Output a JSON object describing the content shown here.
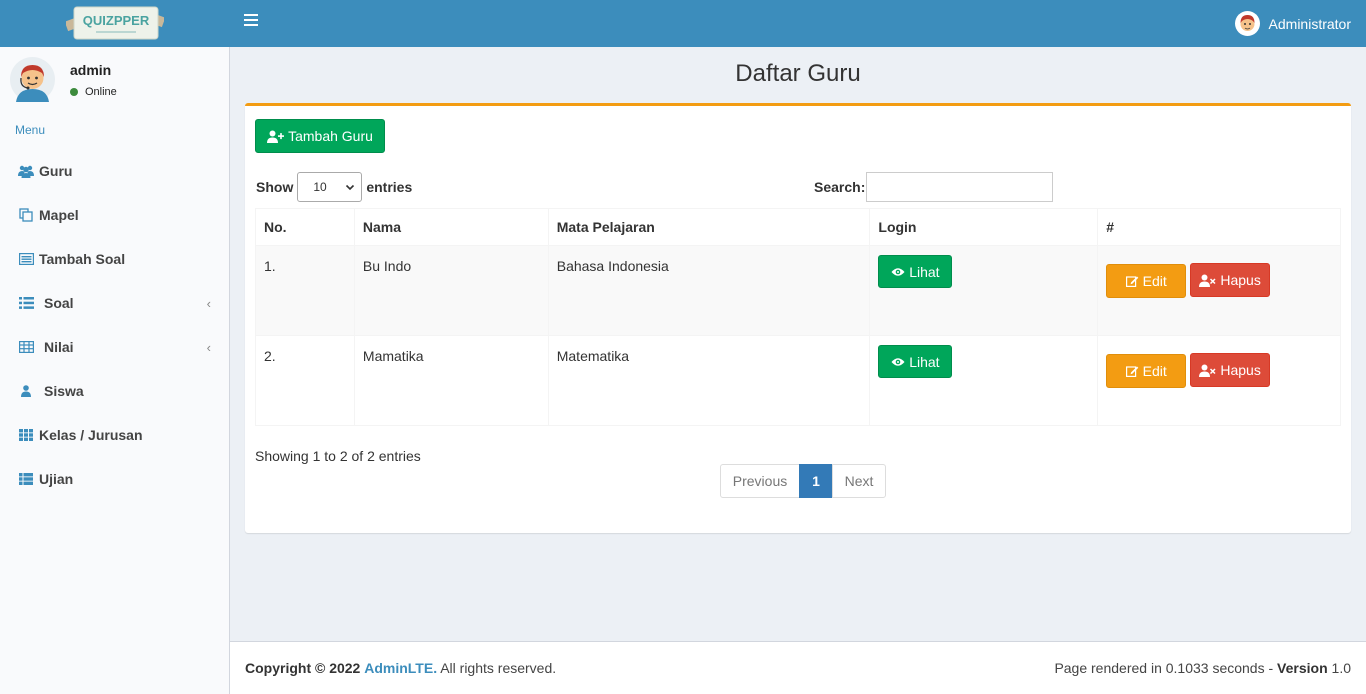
{
  "header": {
    "logo_text": "QUIZPPER",
    "user_label": "Administrator"
  },
  "sidebar": {
    "user_name": "admin",
    "user_status": "Online",
    "menu_header": "Menu",
    "items": [
      {
        "label": "Guru",
        "icon": "users-icon",
        "has_children": false
      },
      {
        "label": "Mapel",
        "icon": "copy-icon",
        "has_children": false
      },
      {
        "label": "Tambah Soal",
        "icon": "list-alt-icon",
        "has_children": false
      },
      {
        "label": "Soal",
        "icon": "list-icon",
        "has_children": true
      },
      {
        "label": "Nilai",
        "icon": "table-icon",
        "has_children": true
      },
      {
        "label": "Siswa",
        "icon": "user-icon",
        "has_children": false
      },
      {
        "label": "Kelas / Jurusan",
        "icon": "grid-icon",
        "has_children": false
      },
      {
        "label": "Ujian",
        "icon": "th-list-icon",
        "has_children": false
      }
    ]
  },
  "page": {
    "title": "Daftar Guru",
    "add_button": "Tambah Guru",
    "show_label": "Show",
    "entries_value": "10",
    "entries_label": "entries",
    "search_label": "Search:",
    "search_value": ""
  },
  "table": {
    "columns": [
      "No.",
      "Nama",
      "Mata Pelajaran",
      "Login",
      "#"
    ],
    "rows": [
      {
        "no": "1.",
        "nama": "Bu Indo",
        "mapel": "Bahasa Indonesia",
        "login_btn": "Lihat",
        "edit_btn": "Edit",
        "delete_btn": "Hapus"
      },
      {
        "no": "2.",
        "nama": "Mamatika",
        "mapel": "Matematika",
        "login_btn": "Lihat",
        "edit_btn": "Edit",
        "delete_btn": "Hapus"
      }
    ]
  },
  "pagination": {
    "info": "Showing 1 to 2 of 2 entries",
    "previous": "Previous",
    "current": "1",
    "next": "Next"
  },
  "footer": {
    "copyright_prefix": "Copyright © 2022",
    "brand": "AdminLTE.",
    "rights": "All rights reserved.",
    "render_text": "Page rendered in 0.1033 seconds -",
    "version_label": "Version",
    "version_value": "1.0"
  },
  "colors": {
    "header": "#3c8dbc",
    "box_border": "#f39c12",
    "success": "#00a65a",
    "warning": "#f39c12",
    "danger": "#dd4b39",
    "active_page": "#337ab7"
  }
}
